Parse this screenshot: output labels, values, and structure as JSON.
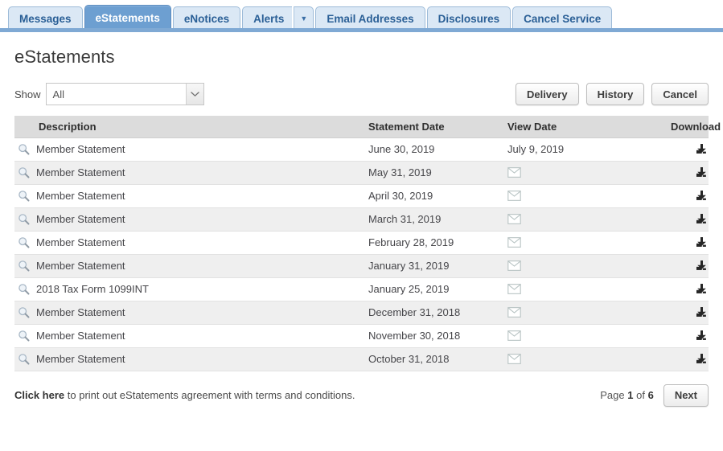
{
  "tabs": [
    {
      "label": "Messages",
      "active": false,
      "has_caret": false
    },
    {
      "label": "eStatements",
      "active": true,
      "has_caret": false
    },
    {
      "label": "eNotices",
      "active": false,
      "has_caret": false
    },
    {
      "label": "Alerts",
      "active": false,
      "has_caret": true
    },
    {
      "label": "Email Addresses",
      "active": false,
      "has_caret": false
    },
    {
      "label": "Disclosures",
      "active": false,
      "has_caret": false
    },
    {
      "label": "Cancel Service",
      "active": false,
      "has_caret": false
    }
  ],
  "page": {
    "title": "eStatements"
  },
  "toolbar": {
    "show_label": "Show",
    "filter_value": "All",
    "filter_options": [
      "All"
    ],
    "delivery_label": "Delivery",
    "history_label": "History",
    "cancel_label": "Cancel"
  },
  "table": {
    "columns": [
      "Description",
      "Statement Date",
      "View Date",
      "Download"
    ],
    "rows": [
      {
        "description": "Member Statement",
        "statement_date": "June 30, 2019",
        "view_date": "July 9, 2019",
        "view_icon": ""
      },
      {
        "description": "Member Statement",
        "statement_date": "May 31, 2019",
        "view_date": "",
        "view_icon": "envelope-icon"
      },
      {
        "description": "Member Statement",
        "statement_date": "April 30, 2019",
        "view_date": "",
        "view_icon": "envelope-icon"
      },
      {
        "description": "Member Statement",
        "statement_date": "March 31, 2019",
        "view_date": "",
        "view_icon": "envelope-icon"
      },
      {
        "description": "Member Statement",
        "statement_date": "February 28, 2019",
        "view_date": "",
        "view_icon": "envelope-icon"
      },
      {
        "description": "Member Statement",
        "statement_date": "January 31, 2019",
        "view_date": "",
        "view_icon": "envelope-icon"
      },
      {
        "description": "2018 Tax Form 1099INT",
        "statement_date": "January 25, 2019",
        "view_date": "",
        "view_icon": "envelope-icon"
      },
      {
        "description": "Member Statement",
        "statement_date": "December 31, 2018",
        "view_date": "",
        "view_icon": "envelope-icon"
      },
      {
        "description": "Member Statement",
        "statement_date": "November 30, 2018",
        "view_date": "",
        "view_icon": "envelope-icon"
      },
      {
        "description": "Member Statement",
        "statement_date": "October 31, 2018",
        "view_date": "",
        "view_icon": "envelope-icon"
      }
    ]
  },
  "footer": {
    "agreement_link": "Click here",
    "agreement_text": " to print out eStatements agreement with terms and conditions.",
    "page_word": "Page",
    "current_page": "1",
    "of_word": "of",
    "total_pages": "6",
    "next_label": "Next"
  },
  "colors": {
    "tab_active_bg": "#6d9fd1",
    "tab_inactive_bg": "#dbe8f5",
    "tab_border": "#9dbbd8",
    "underline_bar": "#7fa9d4",
    "table_header_bg": "#dcdcdc",
    "row_alt_bg": "#efefef",
    "zoom_icon": "#a9b8c6",
    "envelope_icon": "#b9c4c4",
    "download_icon": "#262626"
  }
}
